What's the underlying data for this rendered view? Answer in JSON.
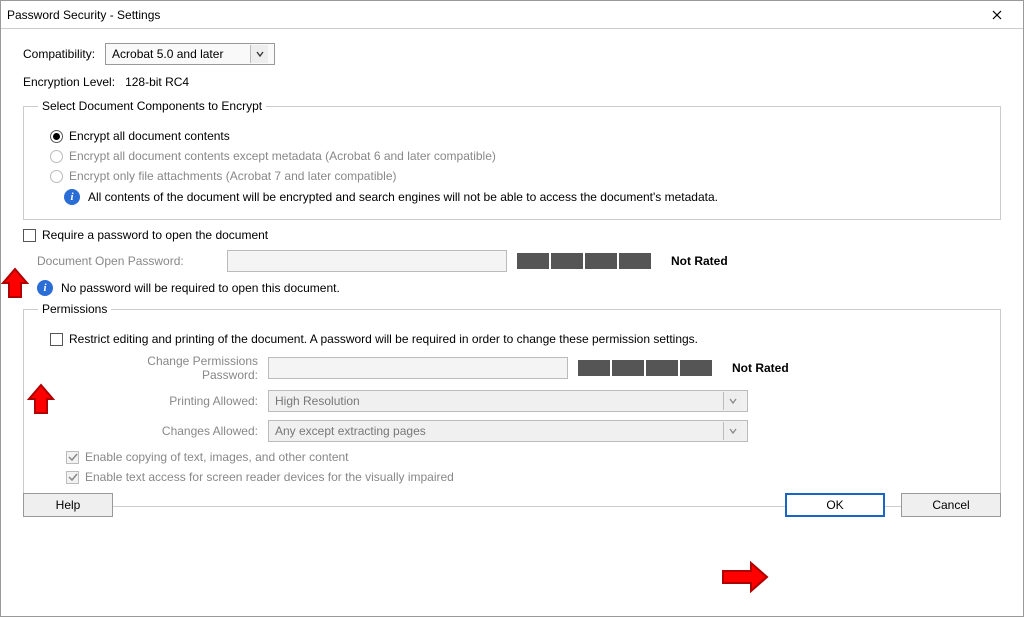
{
  "window": {
    "title": "Password Security - Settings"
  },
  "compat": {
    "label": "Compatibility:",
    "value": "Acrobat 5.0 and later"
  },
  "encryption": {
    "label": "Encryption Level:",
    "value": "128-bit RC4"
  },
  "components": {
    "legend": "Select Document Components to Encrypt",
    "opt_all": "Encrypt all document contents",
    "opt_except_meta": "Encrypt all document contents except metadata (Acrobat 6 and later compatible)",
    "opt_attach_only": "Encrypt only file attachments (Acrobat 7 and later compatible)",
    "info": "All contents of the document will be encrypted and search engines will not be able to access the document's metadata."
  },
  "open_pw": {
    "check_label": "Require a password to open the document",
    "field_label": "Document Open Password:",
    "rating": "Not Rated",
    "info": "No password will be required to open this document."
  },
  "permissions": {
    "legend": "Permissions",
    "restrict_label": "Restrict editing and printing of the document. A password will be required in order to change these permission settings.",
    "change_pw_label": "Change Permissions Password:",
    "rating": "Not Rated",
    "printing_label": "Printing Allowed:",
    "printing_value": "High Resolution",
    "changes_label": "Changes Allowed:",
    "changes_value": "Any except extracting pages",
    "copy_label": "Enable copying of text, images, and other content",
    "reader_label": "Enable text access for screen reader devices for the visually impaired"
  },
  "buttons": {
    "help": "Help",
    "ok": "OK",
    "cancel": "Cancel"
  }
}
